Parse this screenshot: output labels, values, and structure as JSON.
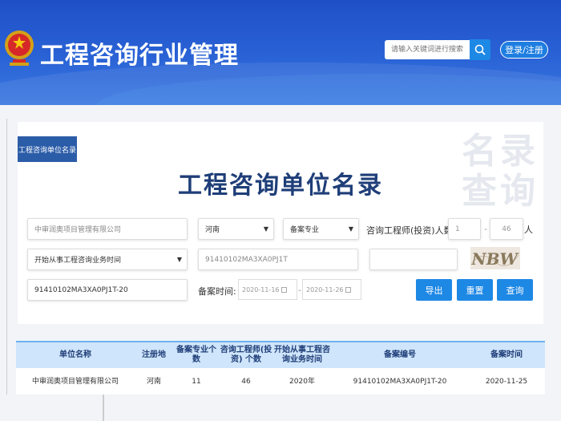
{
  "header": {
    "title": "工程咨询行业管理",
    "search_placeholder": "请输入关键词进行搜索",
    "login_label": "登录/注册"
  },
  "panel": {
    "tab_label": "工程咨询单位名录",
    "watermark": "名录查询",
    "title": "工程咨询单位名录"
  },
  "form": {
    "company_name": "中审润奥项目管理有限公司",
    "region": "河南",
    "specialty": "备案专业",
    "engineer_count_label": "咨询工程师(投资)人数:",
    "engineer_min": "1",
    "engineer_max": "46",
    "engineer_unit": "人",
    "start_time_select": "开始从事工程咨询业务时间",
    "credit_code": "91410102MA3XA0PJ1T",
    "captcha_input": "",
    "captcha_text": "NBW",
    "record_no": "91410102MA3XA0PJ1T-20",
    "record_time_label": "备案时间:",
    "date_from": "2020-11-16",
    "date_to": "2020-11-26",
    "dash": "-",
    "export_label": "导出",
    "reset_label": "重置",
    "query_label": "查询"
  },
  "table": {
    "headers": [
      "单位名称",
      "注册地",
      "备案专业个数",
      "咨询工程师(投资) 个数",
      "开始从事工程咨询业务时间",
      "备案编号",
      "备案时间"
    ],
    "rows": [
      [
        "中审润奥项目管理有限公司",
        "河南",
        "11",
        "46",
        "2020年",
        "91410102MA3XA0PJ1T-20",
        "2020-11-25"
      ]
    ]
  },
  "colors": {
    "header": "#2a63d6",
    "button": "#1e88e5",
    "title": "#1f3e78",
    "tab": "#2b5ca8"
  }
}
